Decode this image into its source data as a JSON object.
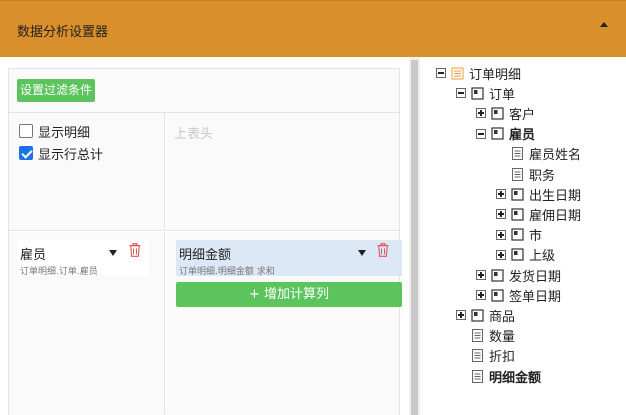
{
  "header": {
    "title": "数据分析设置器"
  },
  "toolbar": {
    "filter_button": "设置过滤条件"
  },
  "options": [
    {
      "label": "显示明细",
      "checked": false
    },
    {
      "label": "显示行总计",
      "checked": true
    }
  ],
  "column_header": {
    "placeholder": "上表头"
  },
  "row_field": {
    "name": "雇员",
    "path": "订单明细.订单.雇员"
  },
  "value_field": {
    "name": "明细金额",
    "path": "订单明细.明细金额 求和"
  },
  "add_button": "+ 增加计算列",
  "tree": [
    {
      "label": "订单明细",
      "toggle": "minus",
      "icon": "table-icon",
      "bold": false
    },
    {
      "label": "订单",
      "toggle": "minus",
      "icon": "relation-icon",
      "bold": false
    },
    {
      "label": "客户",
      "toggle": "plus",
      "icon": "relation-icon",
      "bold": false
    },
    {
      "label": "雇员",
      "toggle": "minus",
      "icon": "relation-icon",
      "bold": true
    },
    {
      "label": "雇员姓名",
      "toggle": "none",
      "icon": "field-icon",
      "bold": false
    },
    {
      "label": "职务",
      "toggle": "none",
      "icon": "field-icon",
      "bold": false
    },
    {
      "label": "出生日期",
      "toggle": "plus",
      "icon": "relation-icon",
      "bold": false
    },
    {
      "label": "雇佣日期",
      "toggle": "plus",
      "icon": "relation-icon",
      "bold": false
    },
    {
      "label": "市",
      "toggle": "plus",
      "icon": "relation-icon",
      "bold": false
    },
    {
      "label": "上级",
      "toggle": "plus",
      "icon": "relation-icon",
      "bold": false
    },
    {
      "label": "发货日期",
      "toggle": "plus",
      "icon": "relation-icon",
      "bold": false
    },
    {
      "label": "签单日期",
      "toggle": "plus",
      "icon": "relation-icon",
      "bold": false
    },
    {
      "label": "商品",
      "toggle": "plus",
      "icon": "relation-icon",
      "bold": false
    },
    {
      "label": "数量",
      "toggle": "none",
      "icon": "field-icon",
      "bold": false
    },
    {
      "label": "折扣",
      "toggle": "none",
      "icon": "field-icon",
      "bold": false
    },
    {
      "label": "明细金额",
      "toggle": "none",
      "icon": "field-icon",
      "bold": true
    }
  ],
  "colors": {
    "header": "#d9902c",
    "accent_green": "#5cc45c",
    "checkbox_blue": "#1a73e8",
    "trash_red": "#e05555",
    "value_card_bg": "#dde8f6"
  }
}
